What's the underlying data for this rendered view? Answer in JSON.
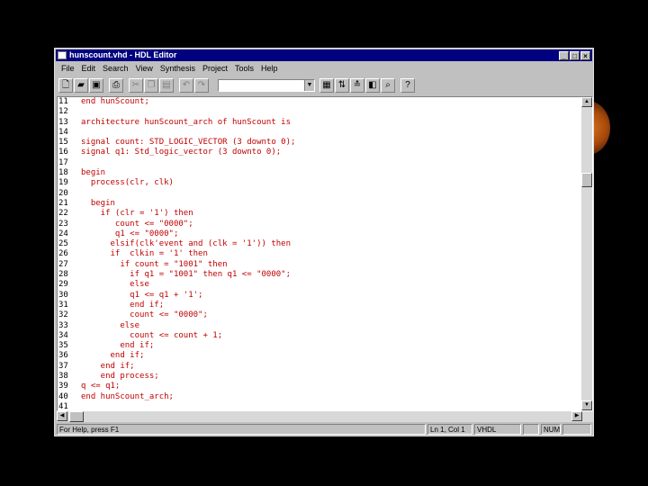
{
  "window": {
    "title": "hunscount.vhd - HDL Editor",
    "controls": [
      "_",
      "□",
      "×"
    ]
  },
  "menu": [
    "File",
    "Edit",
    "Search",
    "View",
    "Synthesis",
    "Project",
    "Tools",
    "Help"
  ],
  "editor": {
    "lines": [
      {
        "n": "11",
        "code": "end hunScount;"
      },
      {
        "n": "12",
        "code": ""
      },
      {
        "n": "13",
        "code": "architecture hunScount_arch of hunScount is"
      },
      {
        "n": "14",
        "code": ""
      },
      {
        "n": "15",
        "code": "signal count: STD_LOGIC_VECTOR (3 downto 0);"
      },
      {
        "n": "16",
        "code": "signal q1: Std_logic_vector (3 downto 0);"
      },
      {
        "n": "17",
        "code": ""
      },
      {
        "n": "18",
        "code": "begin"
      },
      {
        "n": "19",
        "code": "  process(clr, clk)"
      },
      {
        "n": "20",
        "code": ""
      },
      {
        "n": "21",
        "code": "  begin"
      },
      {
        "n": "22",
        "code": "    if (clr = '1') then"
      },
      {
        "n": "23",
        "code": "       count <= \"0000\";"
      },
      {
        "n": "24",
        "code": "       q1 <= \"0000\";"
      },
      {
        "n": "25",
        "code": "      elsif(clk'event and (clk = '1')) then"
      },
      {
        "n": "26",
        "code": "      if  clkin = '1' then"
      },
      {
        "n": "27",
        "code": "        if count = \"1001\" then"
      },
      {
        "n": "28",
        "code": "          if q1 = \"1001\" then q1 <= \"0000\";"
      },
      {
        "n": "29",
        "code": "          else"
      },
      {
        "n": "30",
        "code": "          q1 <= q1 + '1';"
      },
      {
        "n": "31",
        "code": "          end if;"
      },
      {
        "n": "32",
        "code": "          count <= \"0000\";"
      },
      {
        "n": "33",
        "code": "        else"
      },
      {
        "n": "34",
        "code": "          count <= count + 1;"
      },
      {
        "n": "35",
        "code": "        end if;"
      },
      {
        "n": "36",
        "code": "      end if;"
      },
      {
        "n": "37",
        "code": "    end if;"
      },
      {
        "n": "38",
        "code": "    end process;"
      },
      {
        "n": "39",
        "code": "q <= q1;"
      },
      {
        "n": "40",
        "code": "end hunScount_arch;"
      },
      {
        "n": "41",
        "code": ""
      }
    ]
  },
  "status": {
    "help": "For Help, press F1",
    "position": "Ln 1, Col 1",
    "language": "VHDL",
    "num": "NUM"
  },
  "colors": {
    "title_bar": "#000080",
    "code_text": "#c00000",
    "chrome": "#c0c0c0"
  }
}
